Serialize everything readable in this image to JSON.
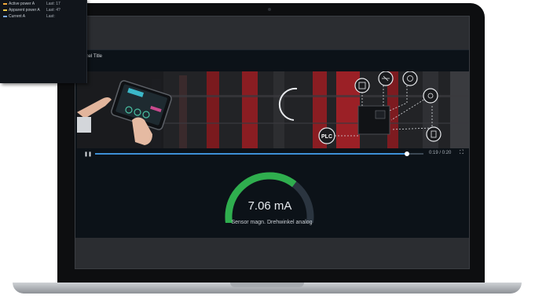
{
  "tooltip": {
    "rows": [
      {
        "label": "Active power A",
        "last": "Last: 17",
        "color": "#f2a93b"
      },
      {
        "label": "Apparent power A",
        "last": "Last: 4?",
        "color": "#e8c84a"
      },
      {
        "label": "Current A",
        "last": "Last:",
        "color": "#7aa7e0"
      }
    ]
  },
  "panel": {
    "title": "Panel Title"
  },
  "video": {
    "overlay_labels": [
      "PLC"
    ],
    "time": "0:19 / 0:20",
    "progress": 0.95,
    "accent": "#3d8fd6"
  },
  "gauge": {
    "value": "7.06 mA",
    "label": "Sensor magn. Drehwinkel analog",
    "fill_fraction": 0.65,
    "color": "#2fae4e"
  }
}
